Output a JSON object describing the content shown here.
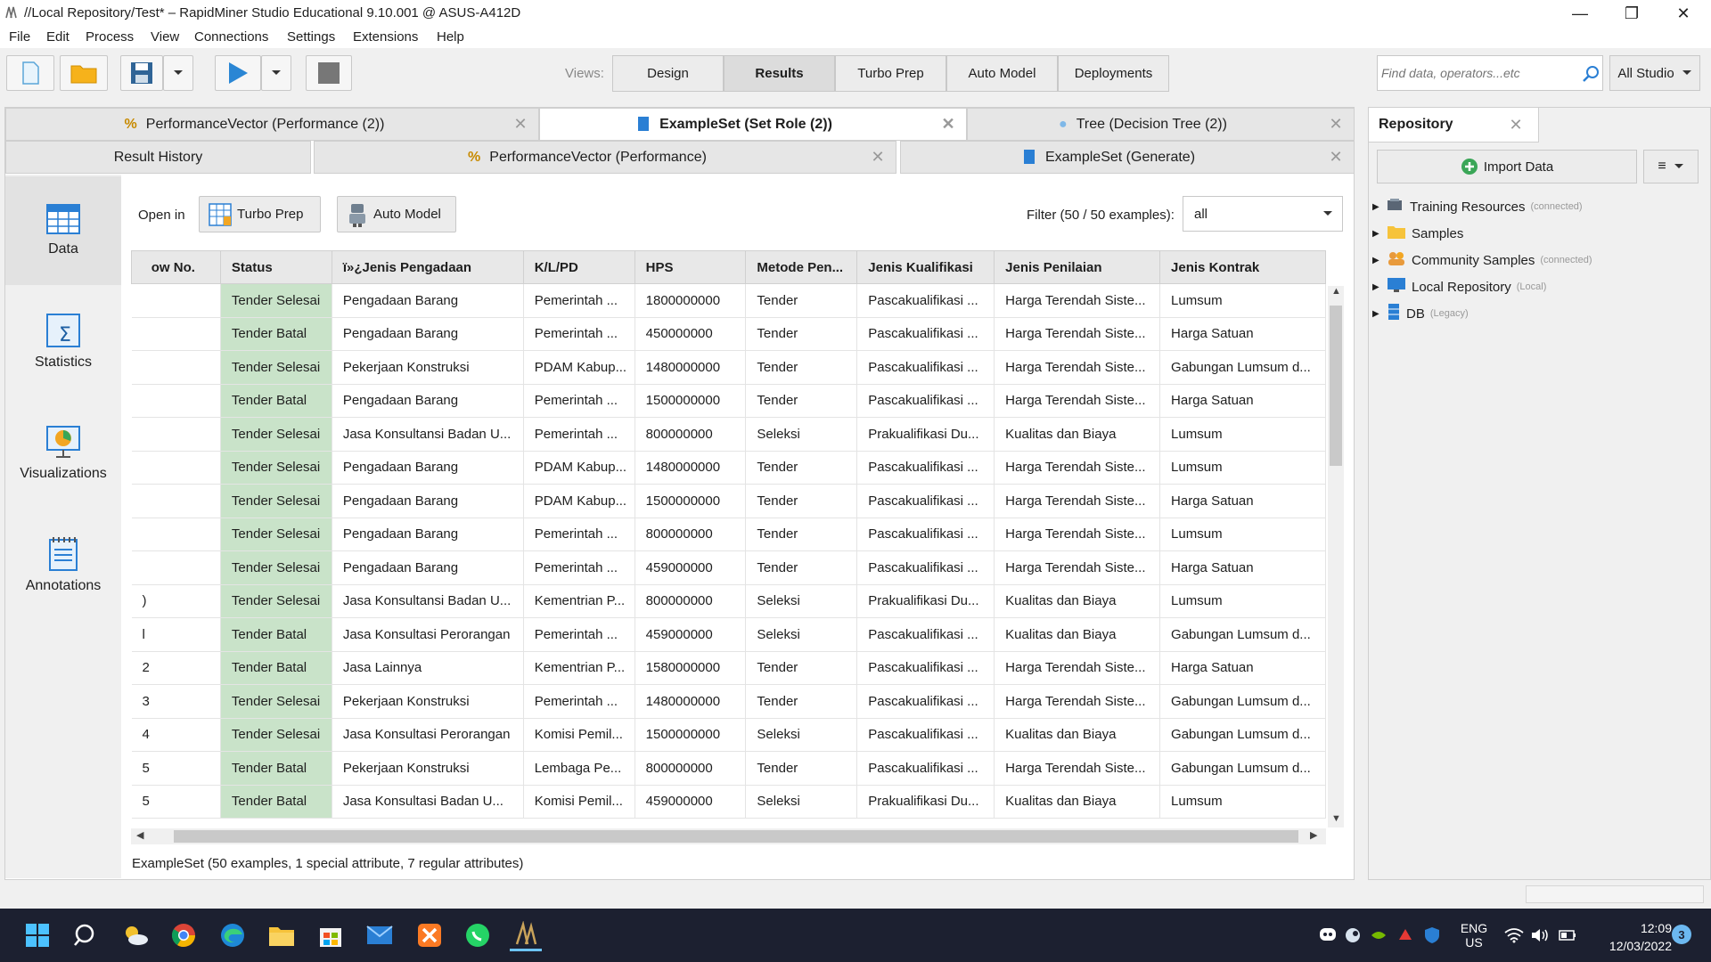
{
  "window": {
    "title": "//Local Repository/Test* – RapidMiner Studio Educational 9.10.001 @ ASUS-A412D",
    "minimize": "—",
    "restore": "❐",
    "close": "✕"
  },
  "menu": [
    "File",
    "Edit",
    "Process",
    "View",
    "Connections",
    "Settings",
    "Extensions",
    "Help"
  ],
  "toolbar": {
    "views_label": "Views:",
    "views": [
      "Design",
      "Results",
      "Turbo Prep",
      "Auto Model",
      "Deployments"
    ],
    "active_view": "Results",
    "search_placeholder": "Find data, operators...etc",
    "scope": "All Studio"
  },
  "result_tabs_row1": [
    {
      "label": "PerformanceVector (Performance (2))",
      "active": false,
      "icon": "percent-icon"
    },
    {
      "label": "ExampleSet (Set Role (2))",
      "active": true,
      "icon": "table-icon"
    },
    {
      "label": "Tree (Decision Tree (2))",
      "active": false,
      "icon": "bulb-icon"
    }
  ],
  "result_tabs_row2": [
    {
      "label": "Result History",
      "active": false
    },
    {
      "label": "PerformanceVector (Performance)",
      "active": false,
      "icon": "percent-icon"
    },
    {
      "label": "ExampleSet (Generate)",
      "active": false,
      "icon": "table-icon"
    }
  ],
  "side_nav": [
    "Data",
    "Statistics",
    "Visualizations",
    "Annotations"
  ],
  "data_view": {
    "open_in": "Open in",
    "turbo_prep": "Turbo Prep",
    "auto_model": "Auto Model",
    "filter_label": "Filter (50 / 50 examples):",
    "filter_value": "all",
    "footer": "ExampleSet (50 examples, 1 special attribute, 7 regular attributes)"
  },
  "table": {
    "columns": [
      "ow No.",
      "Status",
      "ï»¿Jenis Pengadaan",
      "K/L/PD",
      "HPS",
      "Metode Pen...",
      "Jenis Kualifikasi",
      "Jenis Penilaian",
      "Jenis Kontrak"
    ],
    "rows": [
      [
        "",
        "Tender Selesai",
        "Pengadaan Barang",
        "Pemerintah ...",
        "1800000000",
        "Tender",
        "Pascakualifikasi ...",
        "Harga Terendah Siste...",
        "Lumsum"
      ],
      [
        "",
        "Tender Batal",
        "Pengadaan Barang",
        "Pemerintah ...",
        "450000000",
        "Tender",
        "Pascakualifikasi ...",
        "Harga Terendah Siste...",
        "Harga Satuan"
      ],
      [
        "",
        "Tender Selesai",
        "Pekerjaan Konstruksi",
        "PDAM Kabup...",
        "1480000000",
        "Tender",
        "Pascakualifikasi ...",
        "Harga Terendah Siste...",
        "Gabungan Lumsum d..."
      ],
      [
        "",
        "Tender Batal",
        "Pengadaan Barang",
        "Pemerintah ...",
        "1500000000",
        "Tender",
        "Pascakualifikasi ...",
        "Harga Terendah Siste...",
        "Harga Satuan"
      ],
      [
        "",
        "Tender Selesai",
        "Jasa Konsultansi Badan U...",
        "Pemerintah ...",
        "800000000",
        "Seleksi",
        "Prakualifikasi Du...",
        "Kualitas dan Biaya",
        "Lumsum"
      ],
      [
        "",
        "Tender Selesai",
        "Pengadaan Barang",
        "PDAM Kabup...",
        "1480000000",
        "Tender",
        "Pascakualifikasi ...",
        "Harga Terendah Siste...",
        "Lumsum"
      ],
      [
        "",
        "Tender Selesai",
        "Pengadaan Barang",
        "PDAM Kabup...",
        "1500000000",
        "Tender",
        "Pascakualifikasi ...",
        "Harga Terendah Siste...",
        "Harga Satuan"
      ],
      [
        "",
        "Tender Selesai",
        "Pengadaan Barang",
        "Pemerintah ...",
        "800000000",
        "Tender",
        "Pascakualifikasi ...",
        "Harga Terendah Siste...",
        "Lumsum"
      ],
      [
        "",
        "Tender Selesai",
        "Pengadaan Barang",
        "Pemerintah ...",
        "459000000",
        "Tender",
        "Pascakualifikasi ...",
        "Harga Terendah Siste...",
        "Harga Satuan"
      ],
      [
        ")",
        "Tender Selesai",
        "Jasa Konsultansi Badan U...",
        "Kementrian P...",
        "800000000",
        "Seleksi",
        "Prakualifikasi Du...",
        "Kualitas dan Biaya",
        "Lumsum"
      ],
      [
        "l",
        "Tender Batal",
        "Jasa Konsultasi Perorangan",
        "Pemerintah ...",
        "459000000",
        "Seleksi",
        "Pascakualifikasi ...",
        "Kualitas dan Biaya",
        "Gabungan Lumsum d..."
      ],
      [
        "2",
        "Tender Batal",
        "Jasa Lainnya",
        "Kementrian P...",
        "1580000000",
        "Tender",
        "Pascakualifikasi ...",
        "Harga Terendah Siste...",
        "Harga Satuan"
      ],
      [
        "3",
        "Tender Selesai",
        "Pekerjaan Konstruksi",
        "Pemerintah ...",
        "1480000000",
        "Tender",
        "Pascakualifikasi ...",
        "Harga Terendah Siste...",
        "Gabungan Lumsum d..."
      ],
      [
        "4",
        "Tender Selesai",
        "Jasa Konsultasi Perorangan",
        "Komisi Pemil...",
        "1500000000",
        "Seleksi",
        "Pascakualifikasi ...",
        "Kualitas dan Biaya",
        "Gabungan Lumsum d..."
      ],
      [
        "5",
        "Tender Batal",
        "Pekerjaan Konstruksi",
        "Lembaga Pe...",
        "800000000",
        "Tender",
        "Pascakualifikasi ...",
        "Harga Terendah Siste...",
        "Gabungan Lumsum d..."
      ],
      [
        "5",
        "Tender Batal",
        "Jasa Konsultasi Badan U...",
        "Komisi Pemil...",
        "459000000",
        "Seleksi",
        "Prakualifikasi Du...",
        "Kualitas dan Biaya",
        "Lumsum"
      ]
    ]
  },
  "repository": {
    "tab": "Repository",
    "import": "Import Data",
    "items": [
      {
        "label": "Training Resources",
        "note": "(connected)",
        "icon": "training-icon"
      },
      {
        "label": "Samples",
        "note": "",
        "icon": "folder-icon"
      },
      {
        "label": "Community Samples",
        "note": "(connected)",
        "icon": "community-icon"
      },
      {
        "label": "Local Repository",
        "note": "(Local)",
        "icon": "monitor-icon"
      },
      {
        "label": "DB",
        "note": "(Legacy)",
        "icon": "database-icon"
      }
    ]
  },
  "taskbar": {
    "lang": "ENG",
    "region": "US",
    "time": "12:09",
    "date": "12/03/2022",
    "notif": "3"
  },
  "colors": {
    "status_bg": "#c9e3c9",
    "accent": "#2a7fd4",
    "taskbar": "#1c2030"
  }
}
